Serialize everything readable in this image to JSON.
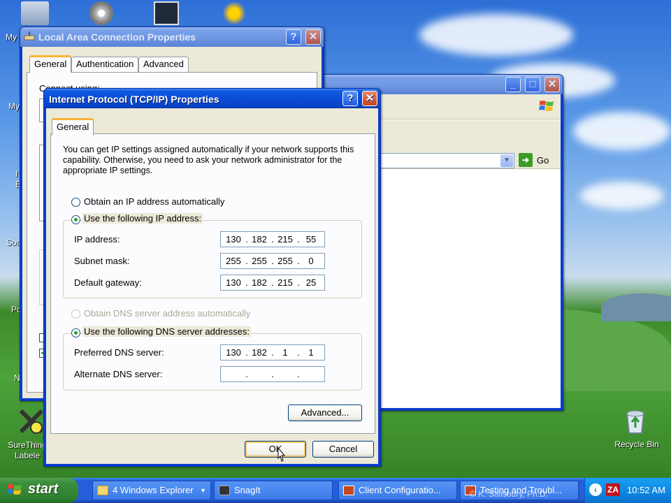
{
  "desktop": {
    "icon_labels": [
      "My",
      "My",
      "Sou",
      "Po",
      "N",
      "SureThing Labele",
      "Recycle Bin"
    ],
    "left_partial": [
      "I",
      "E"
    ]
  },
  "lac_window": {
    "title": "Local Area Connection Properties",
    "tabs": [
      "General",
      "Authentication",
      "Advanced"
    ],
    "partial_label": "Connect using:"
  },
  "explorer_window": {
    "go_label": "Go"
  },
  "tcpip_dialog": {
    "title": "Internet Protocol (TCP/IP) Properties",
    "tab": "General",
    "description": "You can get IP settings assigned automatically if your network supports this capability. Otherwise, you need to ask your network administrator for the appropriate IP settings.",
    "ip_auto_label": "Obtain an IP address automatically",
    "ip_manual_label": "Use the following IP address:",
    "ip_address_label": "IP address:",
    "ip_address": [
      "130",
      "182",
      "215",
      "55"
    ],
    "subnet_label": "Subnet mask:",
    "subnet": [
      "255",
      "255",
      "255",
      "0"
    ],
    "gateway_label": "Default gateway:",
    "gateway": [
      "130",
      "182",
      "215",
      "25"
    ],
    "dns_auto_label": "Obtain DNS server address automatically",
    "dns_manual_label": "Use the following DNS server addresses:",
    "preferred_dns_label": "Preferred DNS server:",
    "preferred_dns": [
      "130",
      "182",
      "1",
      "1"
    ],
    "alternate_dns_label": "Alternate DNS server:",
    "alternate_dns": [
      "",
      "",
      "",
      ""
    ],
    "advanced_button": "Advanced...",
    "ok_button": "OK",
    "cancel_button": "Cancel",
    "help_glyph": "?",
    "close_glyph": "✕"
  },
  "taskbar": {
    "start_label": "start",
    "tasks": [
      "4 Windows Explorer",
      "SnagIt",
      "Client Configuratio...",
      "Testing and Troubl..."
    ],
    "clock": "10:52 AM",
    "footer_text": "© K. Salisbury, Ph.D."
  },
  "colors": {
    "titlebar_active": "#0b4dd6",
    "dialog_face": "#ece9d8",
    "radio_dot": "#21a121",
    "start_green": "#3c8e3c",
    "taskbar_blue": "#245edb"
  }
}
